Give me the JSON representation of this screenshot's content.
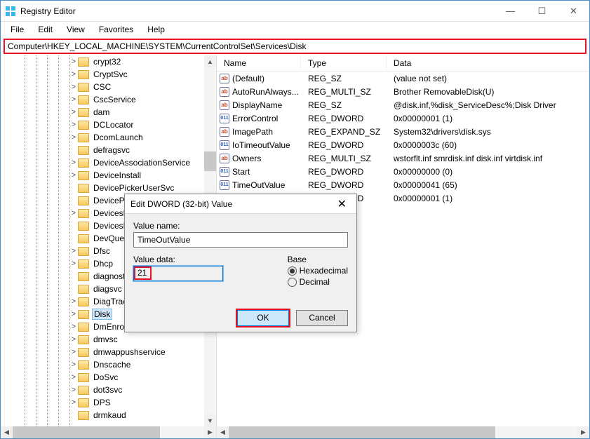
{
  "window": {
    "title": "Registry Editor"
  },
  "menu": {
    "file": "File",
    "edit": "Edit",
    "view": "View",
    "favorites": "Favorites",
    "help": "Help"
  },
  "address": {
    "path": "Computer\\HKEY_LOCAL_MACHINE\\SYSTEM\\CurrentControlSet\\Services\\Disk"
  },
  "tree": [
    {
      "label": "crypt32",
      "exp": "+"
    },
    {
      "label": "CryptSvc",
      "exp": "+"
    },
    {
      "label": "CSC",
      "exp": "+"
    },
    {
      "label": "CscService",
      "exp": "+"
    },
    {
      "label": "dam",
      "exp": "+"
    },
    {
      "label": "DCLocator",
      "exp": "+"
    },
    {
      "label": "DcomLaunch",
      "exp": "+"
    },
    {
      "label": "defragsvc",
      "exp": ""
    },
    {
      "label": "DeviceAssociationService",
      "exp": "+"
    },
    {
      "label": "DeviceInstall",
      "exp": "+"
    },
    {
      "label": "DevicePickerUserSvc",
      "exp": ""
    },
    {
      "label": "DevicePic",
      "exp": ""
    },
    {
      "label": "DevicesFl",
      "exp": "+"
    },
    {
      "label": "DevicesFl",
      "exp": ""
    },
    {
      "label": "DevQuery",
      "exp": ""
    },
    {
      "label": "Dfsc",
      "exp": "+"
    },
    {
      "label": "Dhcp",
      "exp": "+"
    },
    {
      "label": "diagnosti",
      "exp": ""
    },
    {
      "label": "diagsvc",
      "exp": ""
    },
    {
      "label": "DiagTrack",
      "exp": "+"
    },
    {
      "label": "Disk",
      "exp": "+",
      "selected": true
    },
    {
      "label": "DmEnroll",
      "exp": "+"
    },
    {
      "label": "dmvsc",
      "exp": "+"
    },
    {
      "label": "dmwappushservice",
      "exp": "+"
    },
    {
      "label": "Dnscache",
      "exp": "+"
    },
    {
      "label": "DoSvc",
      "exp": "+"
    },
    {
      "label": "dot3svc",
      "exp": "+"
    },
    {
      "label": "DPS",
      "exp": "+"
    },
    {
      "label": "drmkaud",
      "exp": ""
    }
  ],
  "list_head": {
    "name": "Name",
    "type": "Type",
    "data": "Data"
  },
  "list": [
    {
      "icon": "ab",
      "name": "(Default)",
      "type": "REG_SZ",
      "data": "(value not set)"
    },
    {
      "icon": "ab",
      "name": "AutoRunAlways...",
      "type": "REG_MULTI_SZ",
      "data": "Brother RemovableDisk(U)"
    },
    {
      "icon": "ab",
      "name": "DisplayName",
      "type": "REG_SZ",
      "data": "@disk.inf,%disk_ServiceDesc%;Disk Driver"
    },
    {
      "icon": "dw",
      "name": "ErrorControl",
      "type": "REG_DWORD",
      "data": "0x00000001 (1)"
    },
    {
      "icon": "ab",
      "name": "ImagePath",
      "type": "REG_EXPAND_SZ",
      "data": "System32\\drivers\\disk.sys"
    },
    {
      "icon": "dw",
      "name": "IoTimeoutValue",
      "type": "REG_DWORD",
      "data": "0x0000003c (60)"
    },
    {
      "icon": "ab",
      "name": "Owners",
      "type": "REG_MULTI_SZ",
      "data": "wstorflt.inf smrdisk.inf disk.inf virtdisk.inf"
    },
    {
      "icon": "dw",
      "name": "Start",
      "type": "REG_DWORD",
      "data": "0x00000000 (0)"
    },
    {
      "icon": "dw",
      "name": "TimeOutValue",
      "type": "REG_DWORD",
      "data": "0x00000041 (65)"
    },
    {
      "icon": "dw",
      "name": "",
      "type": "REG_DWORD",
      "data": "0x00000001 (1)"
    }
  ],
  "dlg": {
    "title": "Edit DWORD (32-bit) Value",
    "vn_label": "Value name:",
    "vn_value": "TimeOutValue",
    "vd_label": "Value data:",
    "vd_value": "21",
    "base_label": "Base",
    "hex": "Hexadecimal",
    "dec": "Decimal",
    "ok": "OK",
    "cancel": "Cancel"
  }
}
